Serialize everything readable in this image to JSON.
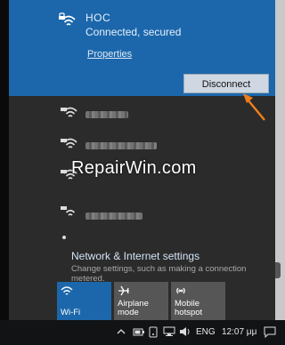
{
  "connected_network": {
    "name": "HOC",
    "status": "Connected, secured",
    "properties_label": "Properties",
    "disconnect_label": "Disconnect"
  },
  "watermark": "RepairWin.com",
  "network_settings": {
    "title": "Network & Internet settings",
    "description": "Change settings, such as making a connection metered."
  },
  "quick_actions": [
    {
      "label": "Wi-Fi",
      "active": true
    },
    {
      "label": "Airplane mode",
      "active": false
    },
    {
      "label": "Mobile hotspot",
      "active": false
    }
  ],
  "taskbar": {
    "language": "ENG",
    "time": "12:07 μμ"
  },
  "colors": {
    "accent": "#1c67ab",
    "flyout_bg": "#2b2b2b",
    "tile_inactive": "#565656",
    "arrow": "#ef7f1a"
  },
  "icons": [
    "wifi-secured-icon",
    "airplane-icon",
    "mobile-hotspot-icon",
    "chevron-up-icon",
    "battery-icon",
    "notification-icon"
  ]
}
